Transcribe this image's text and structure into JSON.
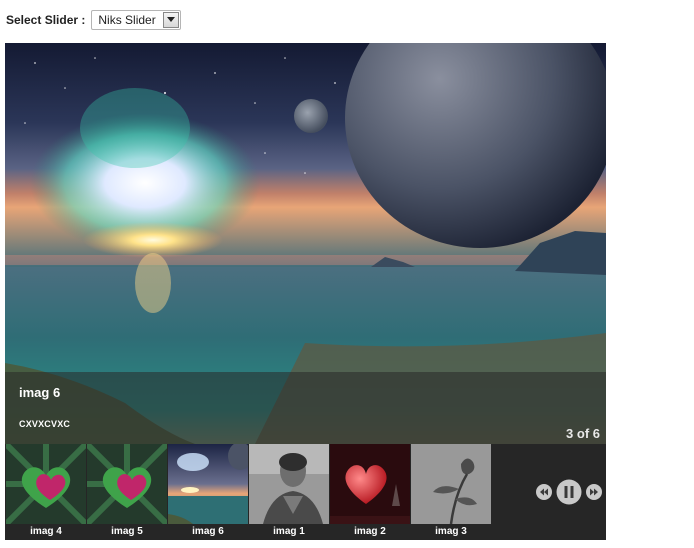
{
  "select": {
    "label": "Select Slider :",
    "value": "Niks Slider"
  },
  "slide": {
    "title": "imag 6",
    "description": "CXVXCVXC",
    "counter": "3 of 6"
  },
  "thumbnails": [
    {
      "label": "imag 4"
    },
    {
      "label": "imag 5"
    },
    {
      "label": "imag 6"
    },
    {
      "label": "imag 1"
    },
    {
      "label": "imag 2"
    },
    {
      "label": "imag 3"
    }
  ]
}
